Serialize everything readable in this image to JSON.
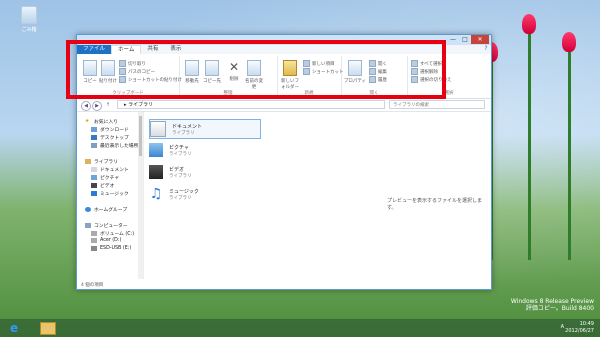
{
  "desktop": {
    "recycle_bin_label": "ごみ箱"
  },
  "window": {
    "minimize": "—",
    "maximize": "□",
    "close": "✕",
    "tabs": [
      {
        "label": "ファイル"
      },
      {
        "label": "ホーム"
      },
      {
        "label": "共有"
      },
      {
        "label": "表示"
      }
    ],
    "help": "?"
  },
  "ribbon": {
    "clipboard": {
      "label": "クリップボード",
      "copy": "コピー",
      "paste": "貼り付け",
      "cut": "切り取り",
      "copy_path": "パスのコピー",
      "paste_shortcut": "ショートカットの貼り付け"
    },
    "organize": {
      "label": "整理",
      "move_to": "移動先",
      "copy_to": "コピー先",
      "delete": "削除",
      "rename": "名前の変更"
    },
    "new": {
      "label": "新規",
      "new_folder": "新しいフォルダー",
      "new_item": "新しい項目",
      "shortcut": "ショートカット"
    },
    "open": {
      "label": "開く",
      "properties": "プロパティ",
      "open": "開く",
      "edit": "編集",
      "history": "履歴"
    },
    "select": {
      "label": "選択",
      "select_all": "すべて選択",
      "select_none": "選択解除",
      "invert": "選択の切り替え"
    }
  },
  "address": {
    "path": "ライブラリ",
    "search_placeholder": "ライブラリの検索"
  },
  "nav": {
    "favorites": "お気に入り",
    "downloads": "ダウンロード",
    "desktop": "デスクトップ",
    "recent": "最近表示した場所",
    "libraries": "ライブラリ",
    "documents": "ドキュメント",
    "pictures": "ピクチャ",
    "videos": "ビデオ",
    "music": "ミュージック",
    "homegroup": "ホームグループ",
    "computer": "コンピューター",
    "volume_c": "ボリューム (C:)",
    "acer_d": "Acer (D:)",
    "esd_usb": "ESD-USB (E:)"
  },
  "libraries": [
    {
      "name": "ドキュメント",
      "type": "ライブラリ"
    },
    {
      "name": "ピクチャ",
      "type": "ライブラリ"
    },
    {
      "name": "ビデオ",
      "type": "ライブラリ"
    },
    {
      "name": "ミュージック",
      "type": "ライブラリ"
    }
  ],
  "preview_text": "プレビューを表示するファイルを選択します。",
  "status": "4 個の項目",
  "taskbar": {
    "ie_glyph": "e",
    "tray": "A",
    "time": "10:49",
    "date": "2012/06/27"
  },
  "watermark": {
    "line1": "Windows 8 Release Preview",
    "line2": "評価コピー。Build 8400"
  }
}
